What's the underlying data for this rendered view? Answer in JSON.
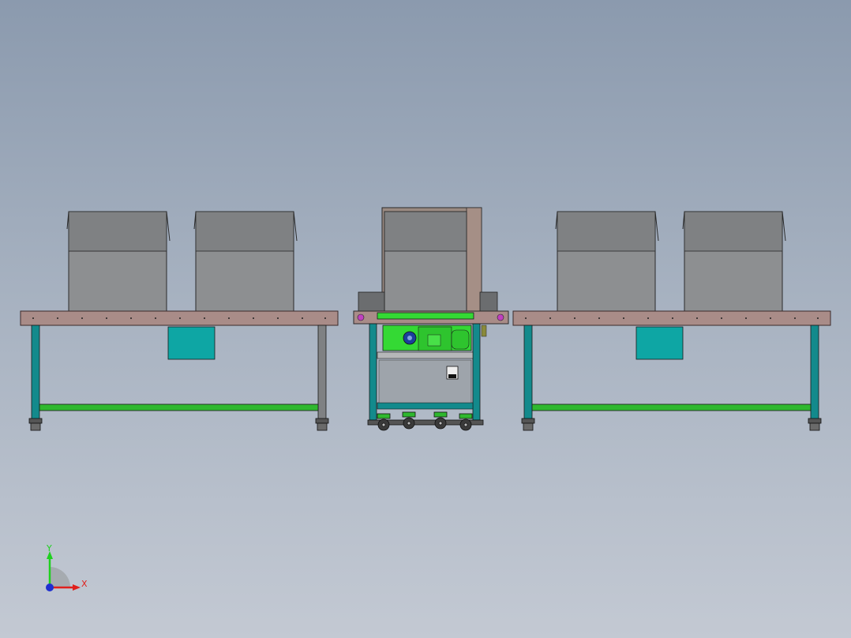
{
  "triad": {
    "x_label": "X",
    "y_label": "Y",
    "x_color": "#e0201c",
    "y_color": "#1fd01f",
    "z_color": "#1f2fd0"
  },
  "colors": {
    "tabletop": "#a98c88",
    "frame": "#138a8c",
    "crossbar": "#2fb82f",
    "box": "#8c8e90",
    "panel": "#0ea6a4",
    "motor": "#34d934"
  }
}
